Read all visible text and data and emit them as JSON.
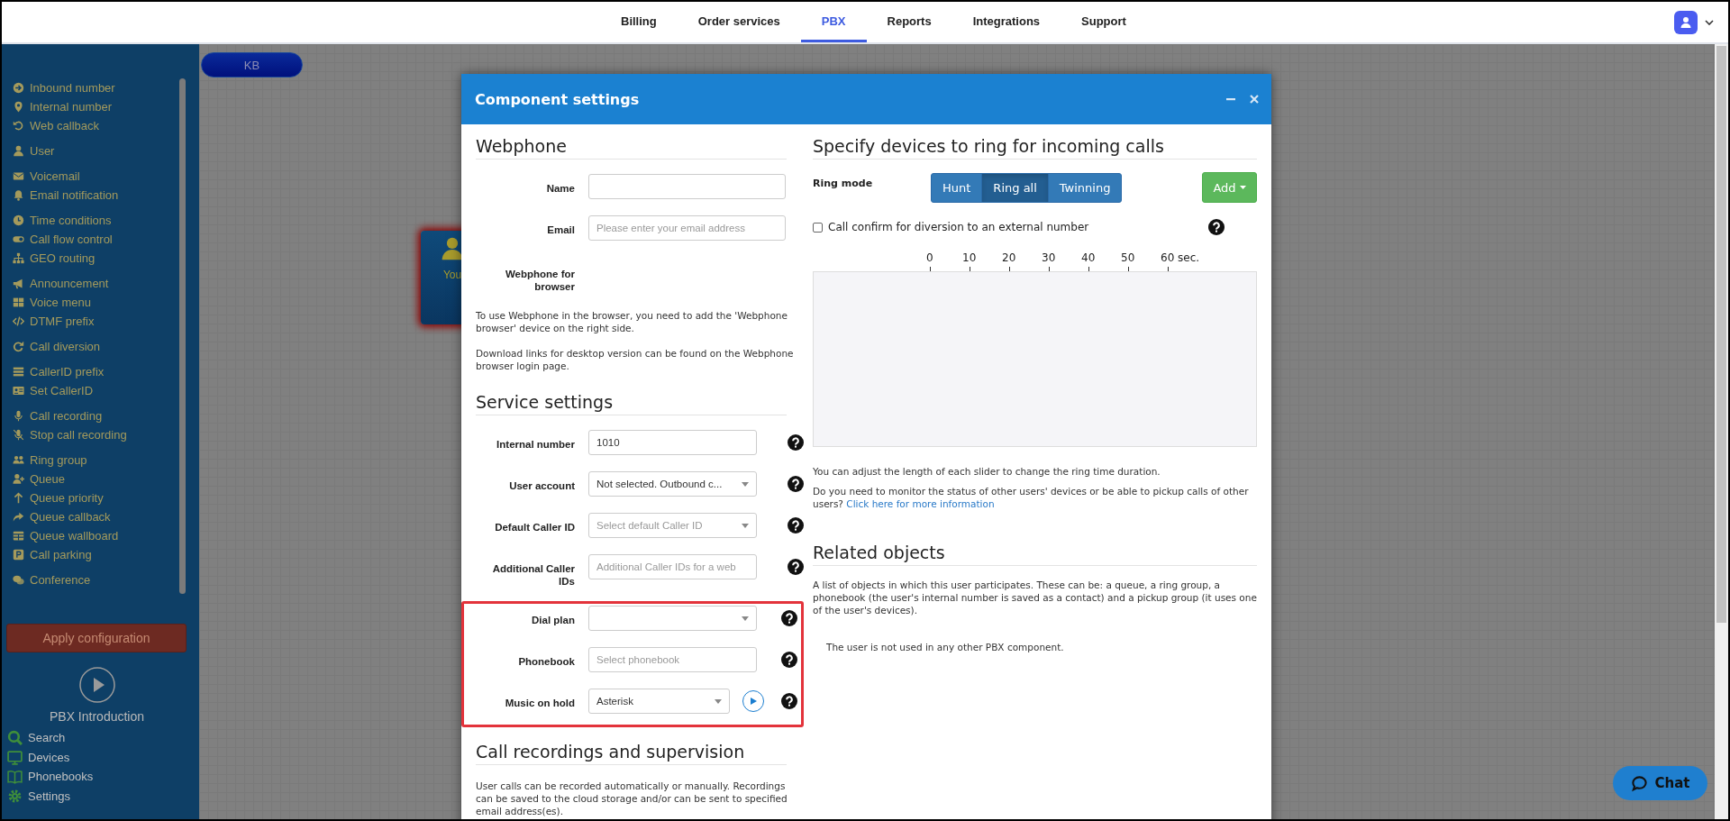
{
  "top_nav": {
    "tabs": [
      {
        "label": "Billing",
        "selected": false
      },
      {
        "label": "Order services",
        "selected": false
      },
      {
        "label": "PBX",
        "selected": true
      },
      {
        "label": "Reports",
        "selected": false
      },
      {
        "label": "Integrations",
        "selected": false
      },
      {
        "label": "Support",
        "selected": false
      }
    ]
  },
  "sidebar": {
    "groups": [
      {
        "items": [
          {
            "label": "Inbound number",
            "kind": "arrow-circle"
          },
          {
            "label": "Internal number",
            "kind": "pin"
          },
          {
            "label": "Web callback",
            "kind": "undo"
          }
        ]
      },
      {
        "items": [
          {
            "label": "User",
            "kind": "user"
          }
        ]
      },
      {
        "items": [
          {
            "label": "Voicemail",
            "kind": "envelope"
          },
          {
            "label": "Email notification",
            "kind": "bell"
          }
        ]
      },
      {
        "items": [
          {
            "label": "Time conditions",
            "kind": "clock"
          },
          {
            "label": "Call flow control",
            "kind": "toggle"
          },
          {
            "label": "GEO routing",
            "kind": "sitemap"
          }
        ]
      },
      {
        "items": [
          {
            "label": "Announcement",
            "kind": "megaphone"
          },
          {
            "label": "Voice menu",
            "kind": "grid"
          },
          {
            "label": "DTMF prefix",
            "kind": "code"
          }
        ]
      },
      {
        "items": [
          {
            "label": "Call diversion",
            "kind": "redo"
          }
        ]
      },
      {
        "items": [
          {
            "label": "CallerID prefix",
            "kind": "list"
          },
          {
            "label": "Set CallerID",
            "kind": "id-card"
          }
        ]
      },
      {
        "items": [
          {
            "label": "Call recording",
            "kind": "mic"
          },
          {
            "label": "Stop call recording",
            "kind": "mic-off"
          }
        ]
      },
      {
        "items": [
          {
            "label": "Ring group",
            "kind": "users"
          },
          {
            "label": "Queue",
            "kind": "user-plus"
          },
          {
            "label": "Queue priority",
            "kind": "arrow-up"
          },
          {
            "label": "Queue callback",
            "kind": "share"
          },
          {
            "label": "Queue wallboard",
            "kind": "table"
          },
          {
            "label": "Call parking",
            "kind": "parking"
          }
        ]
      },
      {
        "items": [
          {
            "label": "Conference",
            "kind": "comments"
          }
        ]
      }
    ],
    "apply_button": "Apply configuration",
    "intro_label": "PBX Introduction",
    "links": [
      {
        "label": "Search",
        "kind": "search"
      },
      {
        "label": "Devices",
        "kind": "monitor"
      },
      {
        "label": "Phonebooks",
        "kind": "book"
      },
      {
        "label": "Settings",
        "kind": "gear"
      }
    ]
  },
  "canvas": {
    "nodes": [
      {
        "kind": "pill",
        "label": "KB",
        "error": false
      },
      {
        "kind": "user",
        "label": "You",
        "error": true
      }
    ]
  },
  "modal": {
    "title": "Component settings",
    "webphone": {
      "heading": "Webphone",
      "rows": [
        {
          "label": "Name",
          "kind": "text"
        },
        {
          "label": "Email",
          "kind": "text",
          "placeholder": "Please enter your email address"
        },
        {
          "label": "Webphone for browser",
          "kind": "none"
        }
      ],
      "paragraphs": [
        "To use Webphone in the browser, you need to add the 'Webphone browser' device on the right side.",
        "Download links for desktop version can be found on the Webphone browser login page."
      ]
    },
    "service": {
      "heading": "Service settings",
      "rows": [
        {
          "label": "Internal number",
          "kind": "text",
          "value": "1010",
          "help": true
        },
        {
          "label": "User account",
          "kind": "select",
          "value": "Not selected. Outbound c...",
          "help": true
        },
        {
          "label": "Default Caller ID",
          "kind": "select",
          "placeholder": "Select default Caller ID",
          "help": true
        },
        {
          "label": "Additional Caller IDs",
          "kind": "text",
          "placeholder": "Additional Caller IDs for a web",
          "help": true
        }
      ],
      "highlighted_rows": [
        {
          "label": "Dial plan",
          "kind": "select",
          "help": true
        },
        {
          "label": "Phonebook",
          "kind": "text",
          "placeholder": "Select phonebook",
          "help": true
        },
        {
          "label": "Music on hold",
          "kind": "select",
          "value": "Asterisk",
          "play_button": true,
          "help": true
        }
      ]
    },
    "recordings": {
      "heading": "Call recordings and supervision",
      "text": "User calls can be recorded automatically or manually. Recordings can be saved to the cloud storage and/or can be sent to specified email address(es)."
    },
    "devices": {
      "heading": "Specify devices to ring for incoming calls",
      "ring_mode": {
        "label": "Ring mode",
        "options": [
          {
            "label": "Hunt",
            "selected": false
          },
          {
            "label": "Ring all",
            "selected": true
          },
          {
            "label": "Twinning",
            "selected": false
          }
        ]
      },
      "add_button": "Add",
      "confirm": {
        "label": "Call confirm for diversion to an external number",
        "checked": false,
        "help": true
      },
      "ruler": [
        "0",
        "10",
        "20",
        "30",
        "40",
        "50",
        "60 sec."
      ],
      "hint": "You can adjust the length of each slider to change the ring time duration.",
      "monitor": {
        "text": "Do you need to monitor the status of other users' devices or be able to pickup calls of other users?",
        "link": "Click here for more information"
      }
    },
    "related": {
      "heading": "Related objects",
      "text": "A list of objects in which this user participates. These can be: a queue, a ring group, a phonebook (the user's internal number is saved as a contact) and a pickup group (it uses one of the user's devices).",
      "empty_note": "The user is not used in any other PBX component."
    }
  },
  "chat_button": "Chat"
}
